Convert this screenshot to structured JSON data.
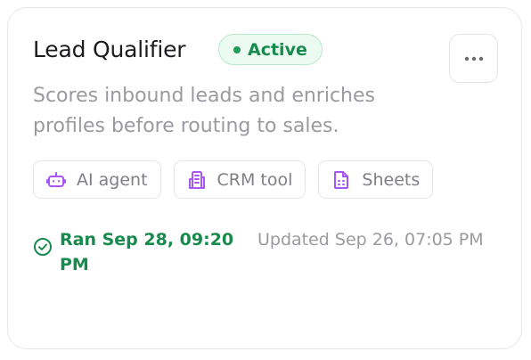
{
  "card": {
    "title": "Lead Qualifier",
    "status": "Active",
    "description": "Scores inbound leads and enriches profiles before routing to sales.",
    "tags": [
      {
        "label": "AI agent",
        "icon": "robot-icon"
      },
      {
        "label": "CRM tool",
        "icon": "building-icon"
      },
      {
        "label": "Sheets",
        "icon": "spreadsheet-icon"
      }
    ],
    "last_run": "Ran Sep 28, 09:20 PM",
    "last_updated": "Updated Sep 26, 07:05 PM",
    "more_icon": "more-horizontal-icon"
  },
  "colors": {
    "status_green": "#188a4e",
    "status_bg": "#ecfbf2",
    "tag_icon_purple": "#a855f7",
    "muted_text": "#9a9aa1"
  }
}
